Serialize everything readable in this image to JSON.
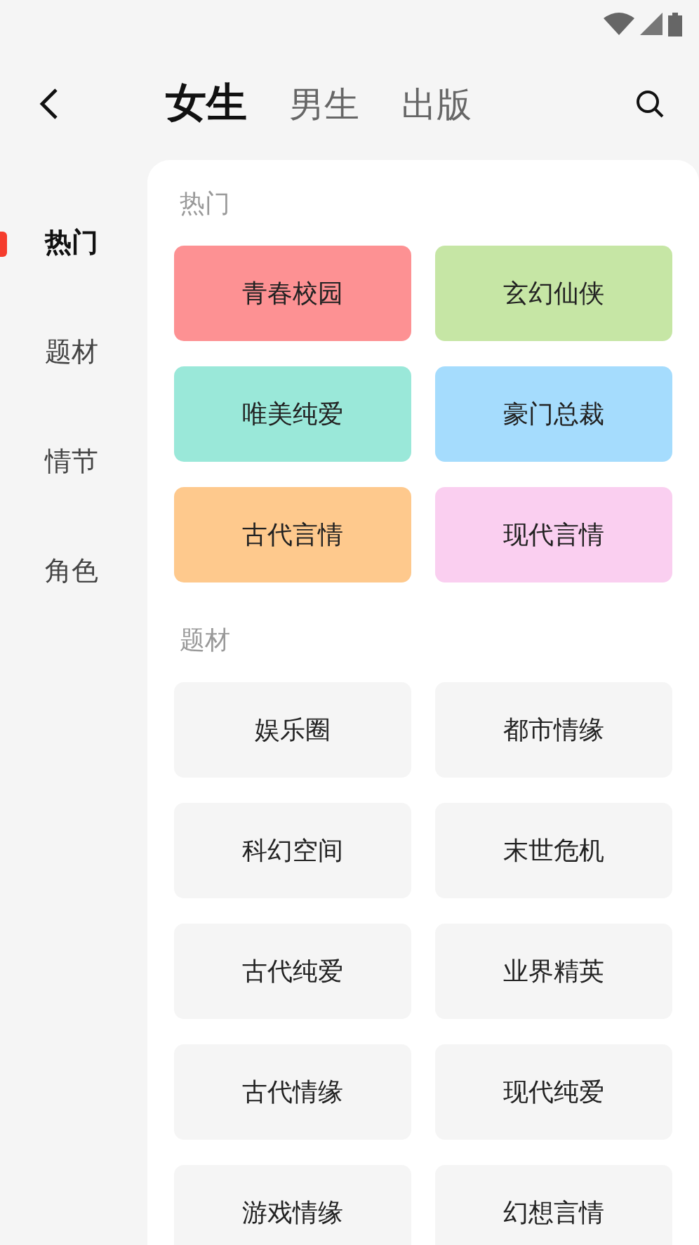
{
  "tabs": [
    {
      "label": "女生",
      "selected": true
    },
    {
      "label": "男生",
      "selected": false
    },
    {
      "label": "出版",
      "selected": false
    }
  ],
  "sidebar": {
    "items": [
      {
        "label": "热门",
        "selected": true
      },
      {
        "label": "题材",
        "selected": false
      },
      {
        "label": "情节",
        "selected": false
      },
      {
        "label": "角色",
        "selected": false
      }
    ]
  },
  "sections": [
    {
      "title": "热门",
      "tags": [
        {
          "label": "青春校园",
          "color": "#fd9193"
        },
        {
          "label": "玄幻仙侠",
          "color": "#c6e6a5"
        },
        {
          "label": "唯美纯爱",
          "color": "#9ae8d9"
        },
        {
          "label": "豪门总裁",
          "color": "#a5dcfd"
        },
        {
          "label": "古代言情",
          "color": "#fec98d"
        },
        {
          "label": "现代言情",
          "color": "#facff0"
        }
      ]
    },
    {
      "title": "题材",
      "tags": [
        {
          "label": "娱乐圈"
        },
        {
          "label": "都市情缘"
        },
        {
          "label": "科幻空间"
        },
        {
          "label": "末世危机"
        },
        {
          "label": "古代纯爱"
        },
        {
          "label": "业界精英"
        },
        {
          "label": "古代情缘"
        },
        {
          "label": "现代纯爱"
        },
        {
          "label": "游戏情缘"
        },
        {
          "label": "幻想言情"
        }
      ]
    }
  ]
}
